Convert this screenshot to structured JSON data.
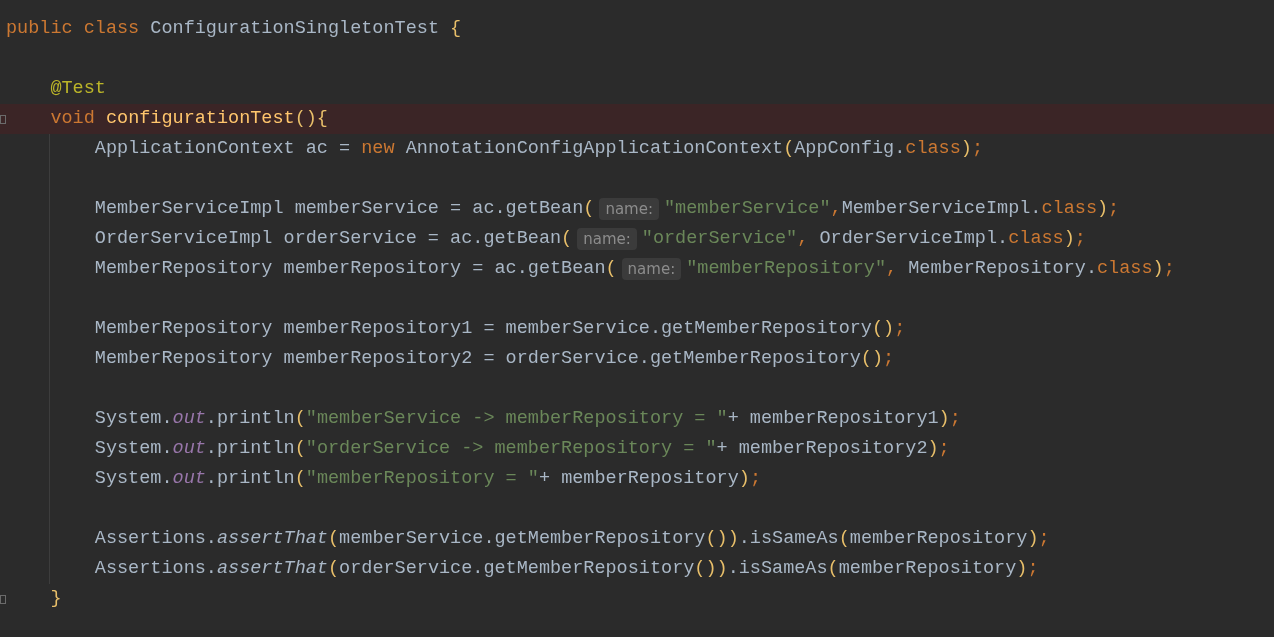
{
  "editor": {
    "lines": [
      {
        "highlighted": false,
        "fold": false,
        "tokens": [
          {
            "text": "public class",
            "kind": "keyword"
          },
          {
            "text": " ConfigurationSingletonTest ",
            "kind": "plain"
          },
          {
            "text": "{",
            "kind": "brace"
          }
        ]
      },
      {
        "highlighted": false,
        "fold": false
      },
      {
        "highlighted": false,
        "fold": false,
        "tokens": [
          {
            "text": "    @Test",
            "kind": "annotation"
          }
        ]
      },
      {
        "highlighted": true,
        "fold": true,
        "tokens": [
          {
            "text": "    void ",
            "kind": "keyword"
          },
          {
            "text": "configurationTest",
            "kind": "method"
          },
          {
            "text": "(){",
            "kind": "brace"
          }
        ]
      },
      {
        "highlighted": false,
        "fold": false,
        "tokens": [
          {
            "text": "        ApplicationContext ac = ",
            "kind": "plain"
          },
          {
            "text": "new",
            "kind": "keyword"
          },
          {
            "text": " AnnotationConfigApplicationContext",
            "kind": "plain"
          },
          {
            "text": "(",
            "kind": "brace"
          },
          {
            "text": "AppConfig.",
            "kind": "plain"
          },
          {
            "text": "class",
            "kind": "keyword"
          },
          {
            "text": ")",
            "kind": "brace"
          },
          {
            "text": ";",
            "kind": "keyword"
          }
        ]
      },
      {
        "highlighted": false,
        "fold": false
      },
      {
        "highlighted": false,
        "fold": false,
        "tokens": [
          {
            "text": "        MemberServiceImpl memberService = ac.getBean",
            "kind": "plain"
          },
          {
            "text": "(",
            "kind": "brace"
          },
          {
            "text": "name:",
            "kind": "hint"
          },
          {
            "text": "\"memberService\"",
            "kind": "string"
          },
          {
            "text": ",",
            "kind": "keyword"
          },
          {
            "text": "MemberServiceImpl.",
            "kind": "plain"
          },
          {
            "text": "class",
            "kind": "keyword"
          },
          {
            "text": ")",
            "kind": "brace"
          },
          {
            "text": ";",
            "kind": "keyword"
          }
        ]
      },
      {
        "highlighted": false,
        "fold": false,
        "tokens": [
          {
            "text": "        OrderServiceImpl orderService = ac.getBean",
            "kind": "plain"
          },
          {
            "text": "(",
            "kind": "brace"
          },
          {
            "text": "name:",
            "kind": "hint"
          },
          {
            "text": "\"orderService\"",
            "kind": "string"
          },
          {
            "text": ",",
            "kind": "keyword"
          },
          {
            "text": " OrderServiceImpl.",
            "kind": "plain"
          },
          {
            "text": "class",
            "kind": "keyword"
          },
          {
            "text": ")",
            "kind": "brace"
          },
          {
            "text": ";",
            "kind": "keyword"
          }
        ]
      },
      {
        "highlighted": false,
        "fold": false,
        "tokens": [
          {
            "text": "        MemberRepository memberRepository = ac.getBean",
            "kind": "plain"
          },
          {
            "text": "(",
            "kind": "brace"
          },
          {
            "text": "name:",
            "kind": "hint"
          },
          {
            "text": "\"memberRepository\"",
            "kind": "string"
          },
          {
            "text": ",",
            "kind": "keyword"
          },
          {
            "text": " MemberRepository.",
            "kind": "plain"
          },
          {
            "text": "class",
            "kind": "keyword"
          },
          {
            "text": ")",
            "kind": "brace"
          },
          {
            "text": ";",
            "kind": "keyword"
          }
        ]
      },
      {
        "highlighted": false,
        "fold": false
      },
      {
        "highlighted": false,
        "fold": false,
        "tokens": [
          {
            "text": "        MemberRepository memberRepository1 = memberService.getMemberRepository",
            "kind": "plain"
          },
          {
            "text": "()",
            "kind": "brace"
          },
          {
            "text": ";",
            "kind": "keyword"
          }
        ]
      },
      {
        "highlighted": false,
        "fold": false,
        "tokens": [
          {
            "text": "        MemberRepository memberRepository2 = orderService.getMemberRepository",
            "kind": "plain"
          },
          {
            "text": "()",
            "kind": "brace"
          },
          {
            "text": ";",
            "kind": "keyword"
          }
        ]
      },
      {
        "highlighted": false,
        "fold": false
      },
      {
        "highlighted": false,
        "fold": false,
        "tokens": [
          {
            "text": "        System.",
            "kind": "plain"
          },
          {
            "text": "out",
            "kind": "static"
          },
          {
            "text": ".println",
            "kind": "plain"
          },
          {
            "text": "(",
            "kind": "brace"
          },
          {
            "text": "\"memberService -> memberRepository = \"",
            "kind": "string"
          },
          {
            "text": "+ memberRepository1",
            "kind": "plain"
          },
          {
            "text": ")",
            "kind": "brace"
          },
          {
            "text": ";",
            "kind": "keyword"
          }
        ]
      },
      {
        "highlighted": false,
        "fold": false,
        "tokens": [
          {
            "text": "        System.",
            "kind": "plain"
          },
          {
            "text": "out",
            "kind": "static"
          },
          {
            "text": ".println",
            "kind": "plain"
          },
          {
            "text": "(",
            "kind": "brace"
          },
          {
            "text": "\"orderService -> memberRepository = \"",
            "kind": "string"
          },
          {
            "text": "+ memberRepository2",
            "kind": "plain"
          },
          {
            "text": ")",
            "kind": "brace"
          },
          {
            "text": ";",
            "kind": "keyword"
          }
        ]
      },
      {
        "highlighted": false,
        "fold": false,
        "tokens": [
          {
            "text": "        System.",
            "kind": "plain"
          },
          {
            "text": "out",
            "kind": "static"
          },
          {
            "text": ".println",
            "kind": "plain"
          },
          {
            "text": "(",
            "kind": "brace"
          },
          {
            "text": "\"memberRepository = \"",
            "kind": "string"
          },
          {
            "text": "+ memberRepository",
            "kind": "plain"
          },
          {
            "text": ")",
            "kind": "brace"
          },
          {
            "text": ";",
            "kind": "keyword"
          }
        ]
      },
      {
        "highlighted": false,
        "fold": false
      },
      {
        "highlighted": false,
        "fold": false,
        "tokens": [
          {
            "text": "        Assertions.",
            "kind": "plain"
          },
          {
            "text": "assertThat",
            "kind": "static_call"
          },
          {
            "text": "(",
            "kind": "brace"
          },
          {
            "text": "memberService.getMemberRepository",
            "kind": "plain"
          },
          {
            "text": "())",
            "kind": "brace"
          },
          {
            "text": ".isSameAs",
            "kind": "plain"
          },
          {
            "text": "(",
            "kind": "brace"
          },
          {
            "text": "memberRepository",
            "kind": "plain"
          },
          {
            "text": ")",
            "kind": "brace"
          },
          {
            "text": ";",
            "kind": "keyword"
          }
        ]
      },
      {
        "highlighted": false,
        "fold": false,
        "tokens": [
          {
            "text": "        Assertions.",
            "kind": "plain"
          },
          {
            "text": "assertThat",
            "kind": "static_call"
          },
          {
            "text": "(",
            "kind": "brace"
          },
          {
            "text": "orderService.getMemberRepository",
            "kind": "plain"
          },
          {
            "text": "())",
            "kind": "brace"
          },
          {
            "text": ".isSameAs",
            "kind": "plain"
          },
          {
            "text": "(",
            "kind": "brace"
          },
          {
            "text": "memberRepository",
            "kind": "plain"
          },
          {
            "text": ")",
            "kind": "brace"
          },
          {
            "text": ";",
            "kind": "keyword"
          }
        ]
      },
      {
        "highlighted": false,
        "fold": true,
        "tokens": [
          {
            "text": "    }",
            "kind": "brace"
          }
        ]
      }
    ]
  }
}
